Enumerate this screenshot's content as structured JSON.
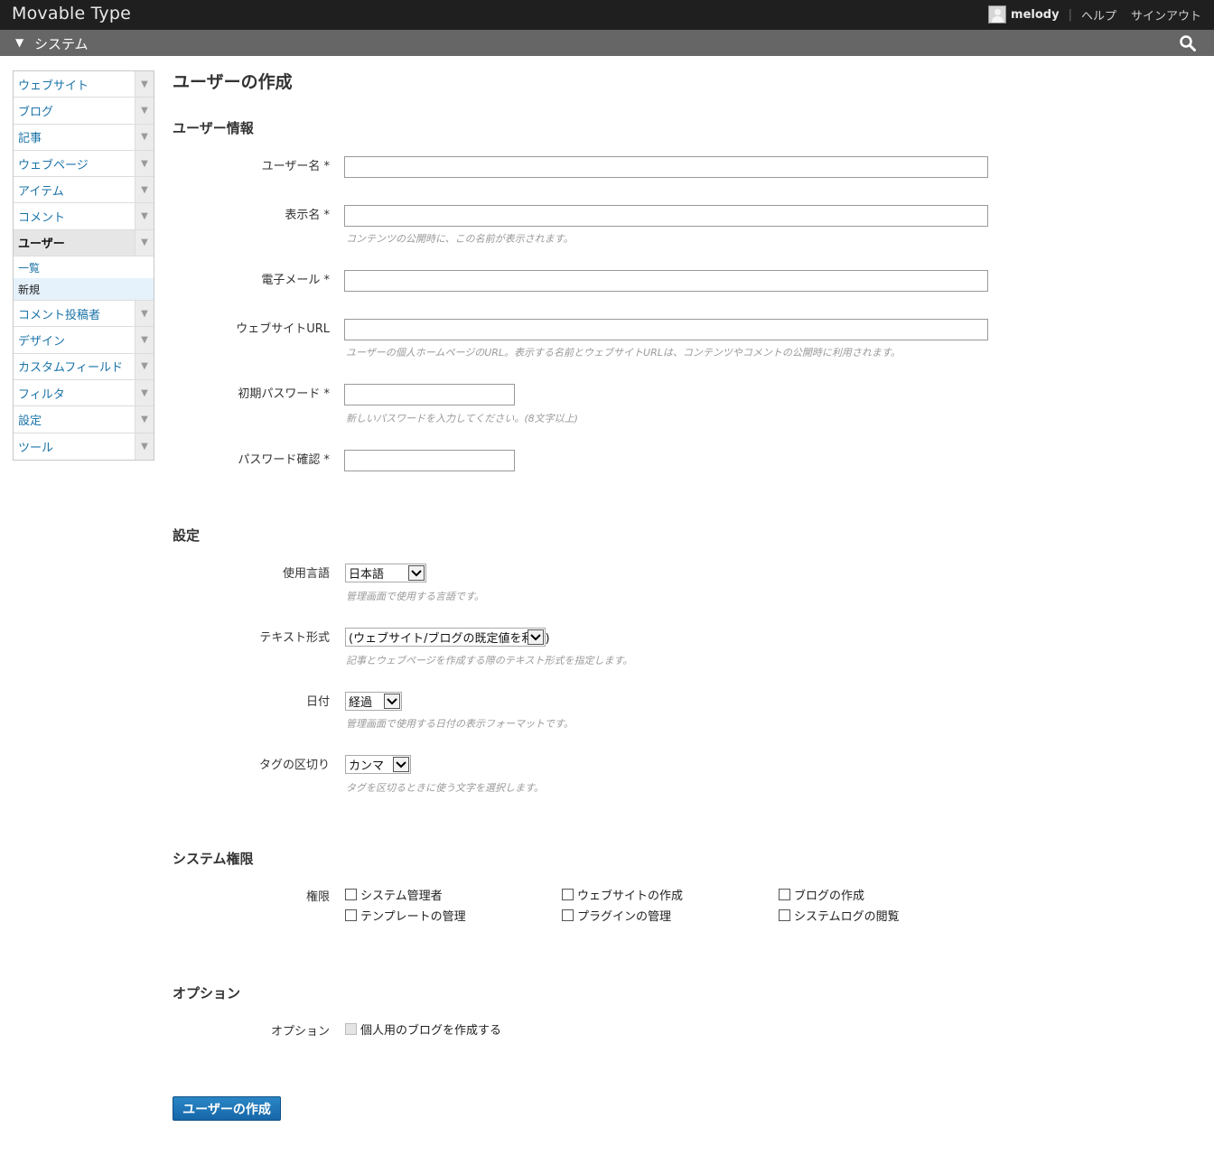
{
  "header": {
    "brand": "Movable Type",
    "username": "melody",
    "separator": "|",
    "help": "ヘルプ",
    "signout": "サインアウト"
  },
  "systembar": {
    "toggle_icon": "▼",
    "label": "システム"
  },
  "sidebar": {
    "items": [
      {
        "label": "ウェブサイト"
      },
      {
        "label": "ブログ"
      },
      {
        "label": "記事"
      },
      {
        "label": "ウェブページ"
      },
      {
        "label": "アイテム"
      },
      {
        "label": "コメント"
      },
      {
        "label": "ユーザー"
      },
      {
        "label": "コメント投稿者"
      },
      {
        "label": "デザイン"
      },
      {
        "label": "カスタムフィールド"
      },
      {
        "label": "フィルタ"
      },
      {
        "label": "設定"
      },
      {
        "label": "ツール"
      }
    ],
    "user_submenu": [
      {
        "label": "一覧"
      },
      {
        "label": "新規"
      }
    ]
  },
  "page": {
    "title": "ユーザーの作成"
  },
  "user_info": {
    "title": "ユーザー情報",
    "username_label": "ユーザー名 *",
    "username_value": "",
    "displayname_label": "表示名 *",
    "displayname_value": "",
    "displayname_hint": "コンテンツの公開時に、この名前が表示されます。",
    "email_label": "電子メール *",
    "email_value": "",
    "url_label": "ウェブサイトURL",
    "url_value": "",
    "url_hint": "ユーザーの個人ホームページのURL。表示する名前とウェブサイトURLは、コンテンツやコメントの公開時に利用されます。",
    "password_label": "初期パスワード *",
    "password_value": "",
    "password_hint": "新しいパスワードを入力してください。(8文字以上)",
    "confirm_label": "パスワード確認 *",
    "confirm_value": ""
  },
  "settings": {
    "title": "設定",
    "language_label": "使用言語",
    "language_value": "日本語",
    "language_hint": "管理画面で使用する言語です。",
    "textformat_label": "テキスト形式",
    "textformat_value": "(ウェブサイト/ブログの既定値を利用)",
    "textformat_hint": "記事とウェブページを作成する際のテキスト形式を指定します。",
    "date_label": "日付",
    "date_value": "経過",
    "date_hint": "管理画面で使用する日付の表示フォーマットです。",
    "tagdelim_label": "タグの区切り",
    "tagdelim_value": "カンマ",
    "tagdelim_hint": "タグを区切るときに使う文字を選択します。"
  },
  "permissions": {
    "title": "システム権限",
    "label": "権限",
    "items": [
      {
        "label": "システム管理者",
        "checked": false
      },
      {
        "label": "ウェブサイトの作成",
        "checked": false
      },
      {
        "label": "ブログの作成",
        "checked": false
      },
      {
        "label": "テンプレートの管理",
        "checked": false
      },
      {
        "label": "プラグインの管理",
        "checked": false
      },
      {
        "label": "システムログの閲覧",
        "checked": false
      }
    ]
  },
  "options": {
    "title": "オプション",
    "label": "オプション",
    "personal_blog_label": "個人用のブログを作成する",
    "personal_blog_checked": false
  },
  "submit": {
    "label": "ユーザーの作成"
  },
  "icons": {
    "search": "search-icon",
    "menu_toggle": "triangle-down-icon",
    "select_arrow": "chevron-down-icon"
  }
}
